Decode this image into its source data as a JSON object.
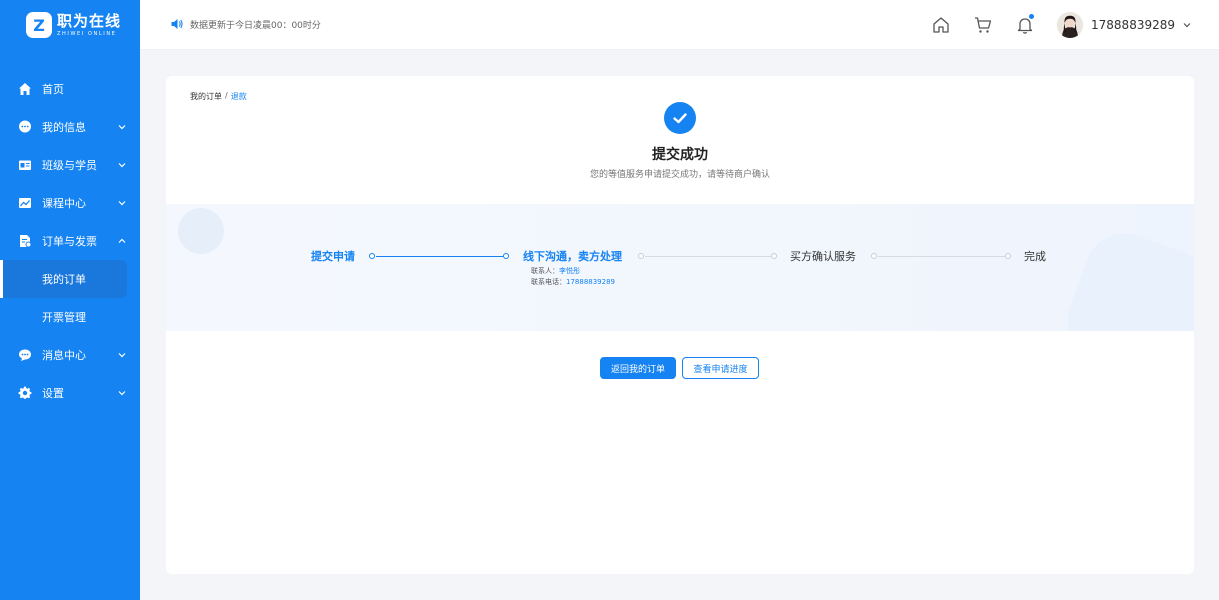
{
  "brand": {
    "mark": "Z",
    "name": "职为在线",
    "name_en": "ZHIWEI ONLINE"
  },
  "sidebar": {
    "items": [
      {
        "label": "首页",
        "icon": "home-icon"
      },
      {
        "label": "我的信息",
        "icon": "chat-bubble-icon"
      },
      {
        "label": "班级与学员",
        "icon": "id-card-icon"
      },
      {
        "label": "课程中心",
        "icon": "chart-icon"
      },
      {
        "label": "订单与发票",
        "icon": "document-icon"
      },
      {
        "label": "我的订单"
      },
      {
        "label": "开票管理"
      },
      {
        "label": "消息中心",
        "icon": "message-icon"
      },
      {
        "label": "设置",
        "icon": "gear-icon"
      }
    ]
  },
  "header": {
    "notice": "数据更新于今日凌晨00：00时分",
    "username": "17888839289"
  },
  "breadcrumb": {
    "root": "我的订单",
    "sep": "/",
    "current": "退款"
  },
  "result": {
    "title": "提交成功",
    "subtitle": "您的等值服务申请提交成功，请等待商户确认"
  },
  "steps": [
    {
      "label": "提交申请",
      "state": "done"
    },
    {
      "label": "线下沟通，卖方处理",
      "state": "done"
    },
    {
      "label": "买方确认服务",
      "state": "todo"
    },
    {
      "label": "完成",
      "state": "todo"
    }
  ],
  "contact": {
    "name_label": "联系人：",
    "name_value": "李悦彤",
    "phone_label": "联系电话：",
    "phone_value": "17888839289"
  },
  "buttons": {
    "back": "返回我的订单",
    "progress": "查看申请进度"
  },
  "colors": {
    "primary": "#1583f2",
    "sidebar_active": "#1a77dc"
  }
}
